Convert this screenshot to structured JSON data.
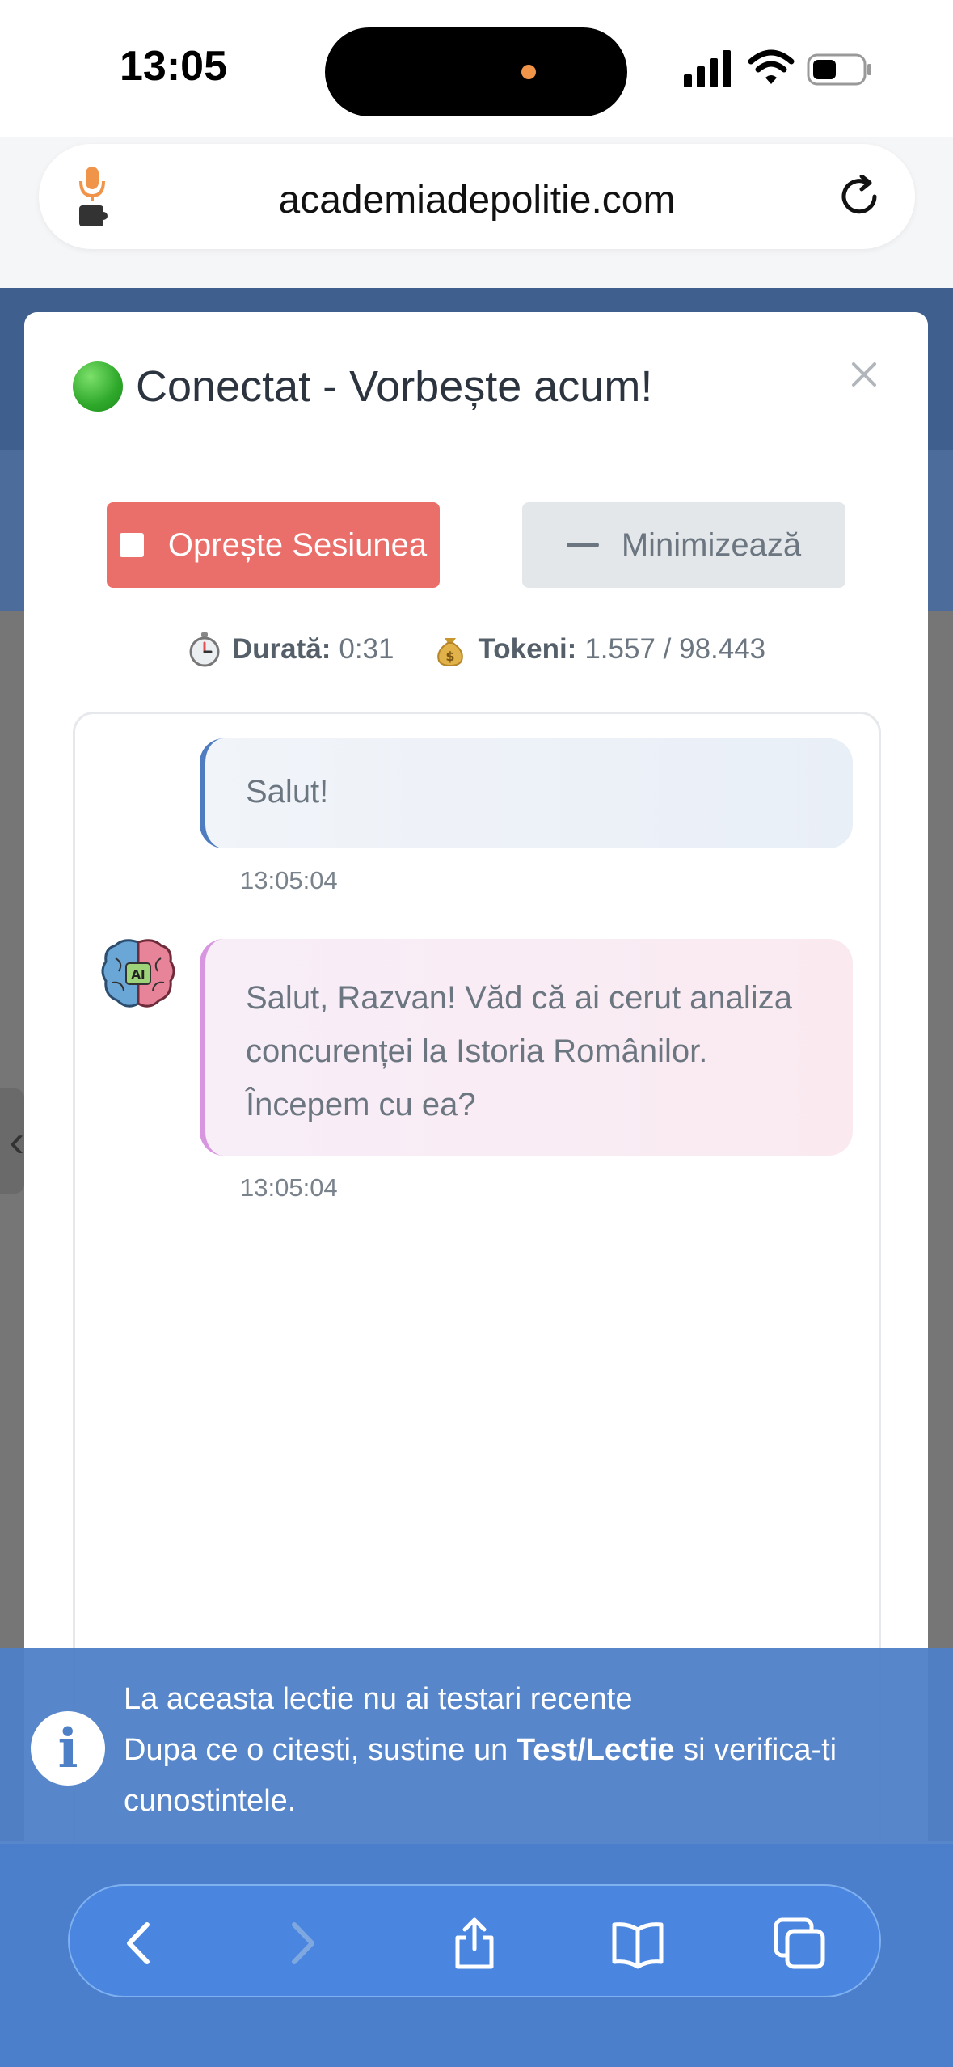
{
  "status_bar": {
    "time": "13:05"
  },
  "browser": {
    "url": "academiadepolitie.com"
  },
  "modal": {
    "title": "Conectat - Vorbește acum!",
    "stop_label": "Oprește Sesiunea",
    "minimize_label": "Minimizează",
    "stats": {
      "duration_label": "Durată:",
      "duration_value": "0:31",
      "tokens_label": "Tokeni:",
      "tokens_value": "1.557 / 98.443"
    },
    "messages": [
      {
        "role": "user",
        "text": "Salut!",
        "time": "13:05:04"
      },
      {
        "role": "ai",
        "text": "Salut, Razvan! Văd că ai cerut analiza concurenței la Istoria Românilor. Începem cu ea?",
        "time": "13:05:04"
      }
    ],
    "avatar_label": "AI"
  },
  "notification": {
    "line1": "La aceasta lectie nu ai testari recente",
    "line2_pre": "Dupa ce o citesti, sustine un ",
    "line2_bold": "Test/Lectie",
    "line2_post": " si verifica-ti cunostintele."
  },
  "icons": {
    "reload": "reload-icon",
    "close": "close-icon",
    "back": "back-icon",
    "forward": "forward-icon",
    "share": "share-icon",
    "bookmarks": "bookmarks-icon",
    "tabs": "tabs-icon",
    "info": "info-icon"
  },
  "colors": {
    "stop_button": "#ea6f6a",
    "minimize_button": "#e4e7ea",
    "user_bubble_accent": "#4f7cc0",
    "ai_bubble_accent": "#d996e0",
    "notification_bg": "#4e80c7",
    "toolbar_bg": "#4a86df"
  }
}
